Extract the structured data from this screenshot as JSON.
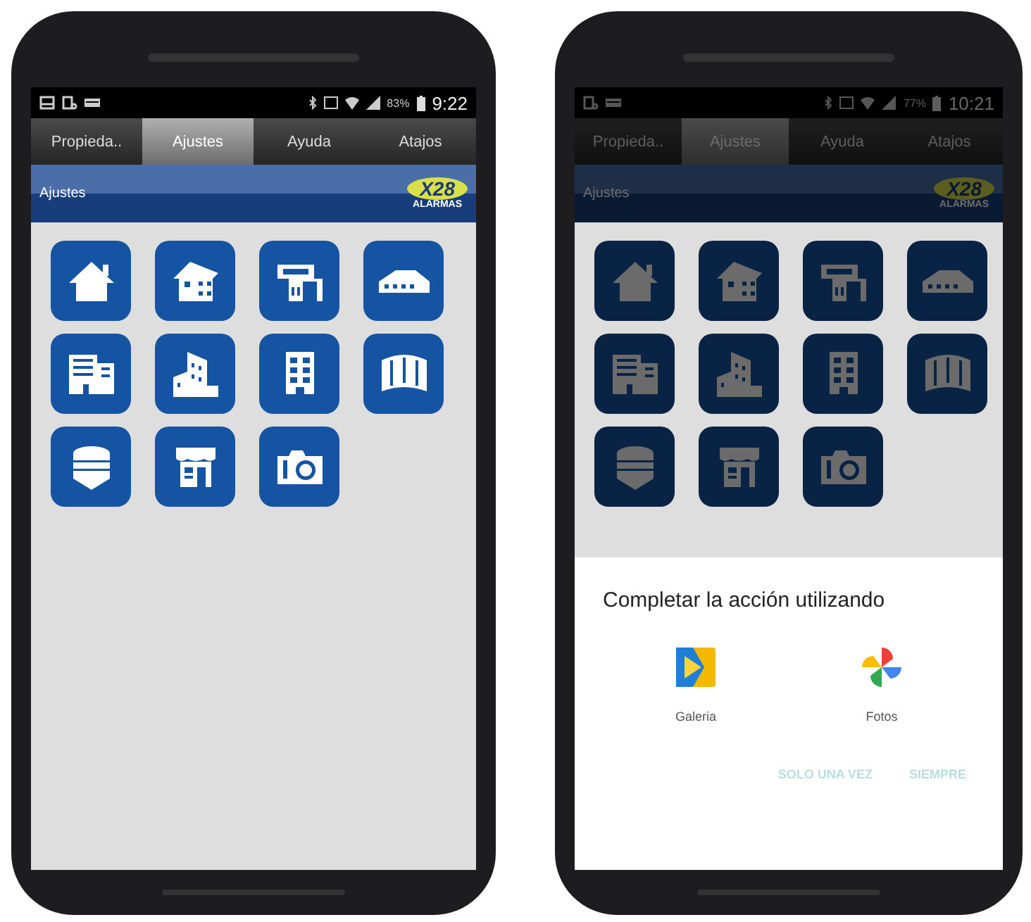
{
  "phones": [
    {
      "dimmed": false,
      "status_bar": {
        "notifications": [
          {
            "kind": "image"
          },
          {
            "kind": "download"
          },
          {
            "kind": "message"
          }
        ],
        "battery": "83%",
        "time": "9:22"
      },
      "tabs": [
        {
          "label": "Propieda..",
          "selected": false
        },
        {
          "label": "Ajustes",
          "selected": true
        },
        {
          "label": "Ayuda",
          "selected": false
        },
        {
          "label": "Atajos",
          "selected": false
        }
      ],
      "header": {
        "title": "Ajustes",
        "logo_text": "X28",
        "logo_subtext": "ALARMAS"
      },
      "tiles": [
        {
          "kind": "house"
        },
        {
          "kind": "cottage"
        },
        {
          "kind": "villa"
        },
        {
          "kind": "warehouse"
        },
        {
          "kind": "office"
        },
        {
          "kind": "tower"
        },
        {
          "kind": "apartment"
        },
        {
          "kind": "curved"
        },
        {
          "kind": "round"
        },
        {
          "kind": "shop"
        },
        {
          "kind": "camera"
        }
      ]
    },
    {
      "dimmed": true,
      "status_bar": {
        "notifications": [
          {
            "kind": "download"
          },
          {
            "kind": "message"
          }
        ],
        "battery": "77%",
        "time": "10:21"
      },
      "tabs": [
        {
          "label": "Propieda..",
          "selected": false
        },
        {
          "label": "Ajustes",
          "selected": true
        },
        {
          "label": "Ayuda",
          "selected": false
        },
        {
          "label": "Atajos",
          "selected": false
        }
      ],
      "header": {
        "title": "Ajustes",
        "logo_text": "X28",
        "logo_subtext": "ALARMAS"
      },
      "tiles": [
        {
          "kind": "house"
        },
        {
          "kind": "cottage"
        },
        {
          "kind": "villa"
        },
        {
          "kind": "warehouse"
        },
        {
          "kind": "office"
        },
        {
          "kind": "tower"
        },
        {
          "kind": "apartment"
        },
        {
          "kind": "curved"
        },
        {
          "kind": "round"
        },
        {
          "kind": "shop"
        },
        {
          "kind": "camera"
        }
      ],
      "dialog": {
        "title": "Completar la acción utilizando",
        "apps": [
          {
            "kind": "gallery",
            "label": "Galeria"
          },
          {
            "kind": "pinwheel",
            "label": "Fotos"
          }
        ],
        "buttons": [
          {
            "label": "SOLO UNA VEZ",
            "disabled": true
          },
          {
            "label": "SIEMPRE",
            "disabled": true
          }
        ]
      }
    }
  ]
}
